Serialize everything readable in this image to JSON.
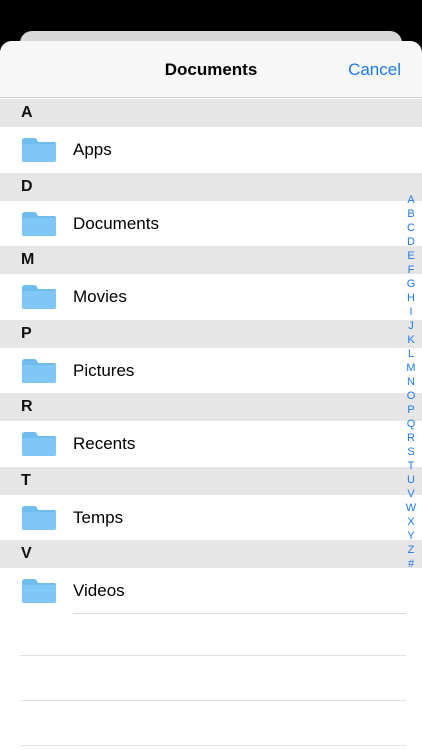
{
  "navbar": {
    "title": "Documents",
    "cancel_label": "Cancel"
  },
  "sections": [
    {
      "header": "A",
      "items": [
        {
          "label": "Apps",
          "icon": "folder-icon"
        }
      ]
    },
    {
      "header": "D",
      "items": [
        {
          "label": "Documents",
          "icon": "folder-icon"
        }
      ]
    },
    {
      "header": "M",
      "items": [
        {
          "label": "Movies",
          "icon": "folder-icon"
        }
      ]
    },
    {
      "header": "P",
      "items": [
        {
          "label": "Pictures",
          "icon": "folder-icon"
        }
      ]
    },
    {
      "header": "R",
      "items": [
        {
          "label": "Recents",
          "icon": "folder-icon"
        }
      ]
    },
    {
      "header": "T",
      "items": [
        {
          "label": "Temps",
          "icon": "folder-icon"
        }
      ]
    },
    {
      "header": "V",
      "items": [
        {
          "label": "Videos",
          "icon": "folder-icon"
        }
      ]
    }
  ],
  "index_letters": [
    "A",
    "B",
    "C",
    "D",
    "E",
    "F",
    "G",
    "H",
    "I",
    "J",
    "K",
    "L",
    "M",
    "N",
    "O",
    "P",
    "Q",
    "R",
    "S",
    "T",
    "U",
    "V",
    "W",
    "X",
    "Y",
    "Z",
    "#"
  ],
  "colors": {
    "accent": "#1a7cf0",
    "folder": "#7fc8f5",
    "section_bg": "#e6e6e6"
  }
}
